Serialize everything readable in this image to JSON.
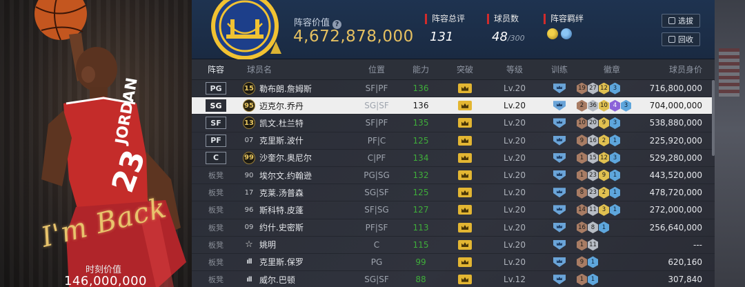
{
  "card": {
    "signature": "I'm Back",
    "value_label": "时刻价值",
    "value": "146,000,000",
    "jersey_text": "JORDAN"
  },
  "header": {
    "lineup_value_label": "阵容价值",
    "lineup_value": "4,672,878,000",
    "total_rating_label": "阵容总评",
    "total_rating": "131",
    "player_count_label": "球员数",
    "player_count": "48",
    "player_count_max": "/300",
    "bond_label": "阵容羁绊",
    "select_button": "选拔",
    "recycle_button": "回收"
  },
  "colors": {
    "accent_gold": "#e5c061",
    "header_red": "#d22b2b",
    "ability_green": "#3fae3a",
    "selected_row": "#eeeeee"
  },
  "table": {
    "headers": [
      "阵容",
      "球员名",
      "位置",
      "能力",
      "突破",
      "等级",
      "训练",
      "徽章",
      "球员身价"
    ],
    "rows": [
      {
        "slot": "PG",
        "ovr": "15",
        "ovr_style": "gold",
        "name": "勒布朗.詹姆斯",
        "position": "SF|PF",
        "ability": "136",
        "level": "Lv.20",
        "badges": [
          [
            "19",
            0
          ],
          [
            "27",
            1
          ],
          [
            "12",
            2
          ],
          [
            "3",
            3
          ]
        ],
        "price": "716,800,000"
      },
      {
        "slot": "SG",
        "ovr": "95",
        "ovr_style": "gold",
        "name": "迈克尔.乔丹",
        "position": "SG|SF",
        "ability": "136",
        "level": "Lv.20",
        "badges": [
          [
            "2",
            0
          ],
          [
            "36",
            1
          ],
          [
            "10",
            2
          ],
          [
            "4",
            4
          ],
          [
            "3",
            3
          ]
        ],
        "price": "704,000,000",
        "selected": true
      },
      {
        "slot": "SF",
        "ovr": "13",
        "ovr_style": "gold",
        "name": "凯文.杜兰特",
        "position": "SF|PF",
        "ability": "135",
        "level": "Lv.20",
        "badges": [
          [
            "10",
            0
          ],
          [
            "20",
            1
          ],
          [
            "9",
            2
          ],
          [
            "3",
            3
          ]
        ],
        "price": "538,880,000"
      },
      {
        "slot": "PF",
        "ovr": "07",
        "ovr_style": "plain",
        "name": "克里斯.波什",
        "position": "PF|C",
        "ability": "125",
        "level": "Lv.20",
        "badges": [
          [
            "9",
            0
          ],
          [
            "16",
            1
          ],
          [
            "2",
            2
          ],
          [
            "1",
            3
          ]
        ],
        "price": "225,920,000"
      },
      {
        "slot": "C",
        "ovr": "99",
        "ovr_style": "gold",
        "name": "沙奎尔.奥尼尔",
        "position": "C|PF",
        "ability": "134",
        "level": "Lv.20",
        "badges": [
          [
            "1",
            0
          ],
          [
            "15",
            1
          ],
          [
            "12",
            2
          ],
          [
            "3",
            3
          ]
        ],
        "price": "529,280,000"
      },
      {
        "slot": "板凳",
        "ovr": "90",
        "ovr_style": "plain",
        "name": "埃尔文.约翰逊",
        "position": "PG|SG",
        "ability": "132",
        "level": "Lv.20",
        "badges": [
          [
            "1",
            0
          ],
          [
            "23",
            1
          ],
          [
            "9",
            2
          ],
          [
            "1",
            3
          ]
        ],
        "price": "443,520,000"
      },
      {
        "slot": "板凳",
        "ovr": "17",
        "ovr_style": "plain",
        "name": "克莱.汤普森",
        "position": "SG|SF",
        "ability": "125",
        "level": "Lv.20",
        "badges": [
          [
            "8",
            0
          ],
          [
            "23",
            1
          ],
          [
            "2",
            2
          ],
          [
            "1",
            3
          ]
        ],
        "price": "478,720,000"
      },
      {
        "slot": "板凳",
        "ovr": "96",
        "ovr_style": "plain",
        "name": "斯科特.皮蓬",
        "position": "SF|SG",
        "ability": "127",
        "level": "Lv.20",
        "badges": [
          [
            "14",
            0
          ],
          [
            "11",
            1
          ],
          [
            "3",
            2
          ],
          [
            "1",
            3
          ]
        ],
        "price": "272,000,000"
      },
      {
        "slot": "板凳",
        "ovr": "09",
        "ovr_style": "plain",
        "name": "约什.史密斯",
        "position": "PF|SF",
        "ability": "113",
        "level": "Lv.20",
        "badges": [
          [
            "16",
            0
          ],
          [
            "8",
            1
          ],
          [
            "1",
            3
          ]
        ],
        "price": "256,640,000"
      },
      {
        "slot": "板凳",
        "ovr": "☆",
        "ovr_style": "star",
        "name": "姚明",
        "position": "C",
        "ability": "115",
        "level": "Lv.20",
        "badges": [
          [
            "1",
            0
          ],
          [
            "11",
            1
          ]
        ],
        "price": "---"
      },
      {
        "slot": "板凳",
        "ovr": "ıll",
        "ovr_style": "bars",
        "name": "克里斯.保罗",
        "position": "PG",
        "ability": "99",
        "level": "Lv.20",
        "badges": [
          [
            "9",
            0
          ],
          [
            "1",
            3
          ]
        ],
        "price": "620,160"
      },
      {
        "slot": "板凳",
        "ovr": "ıll",
        "ovr_style": "bars",
        "name": "威尔.巴顿",
        "position": "SG|SF",
        "ability": "88",
        "level": "Lv.12",
        "badges": [
          [
            "1",
            0
          ],
          [
            "1",
            3
          ]
        ],
        "price": "307,840"
      }
    ]
  }
}
